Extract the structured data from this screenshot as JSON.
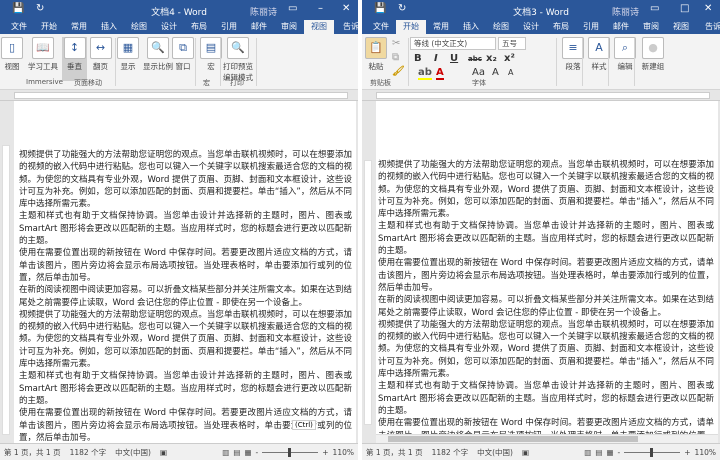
{
  "tabs": [
    "文件",
    "开始",
    "常用",
    "插入",
    "绘图",
    "设计",
    "布局",
    "引用",
    "邮件",
    "审阅",
    "视图"
  ],
  "tell_me": "告诉我",
  "user": "陈丽诗",
  "left": {
    "title": "文档4 - Word",
    "active_tab": 10,
    "buttons": [
      "视图",
      "学习工具",
      "垂直",
      "翻页",
      "显示",
      "显示比例",
      "窗口",
      "宏",
      "打印预览编辑模式"
    ],
    "groups": [
      "Immersive",
      "页面移动",
      "宏",
      "打印"
    ],
    "paste_options": "(Ctrl)"
  },
  "right": {
    "title": "文档3 - Word",
    "active_tab": 1,
    "paste": "粘贴",
    "font_name": "等线 (中文正文)",
    "font_size": "五号",
    "format_buttons": [
      "B",
      "I",
      "U",
      "abc",
      "x₂",
      "x²",
      "Aa",
      "A",
      "A"
    ],
    "buttons": [
      "段落",
      "样式",
      "编辑",
      "新建组"
    ],
    "groups": [
      "剪贴板",
      "字体"
    ]
  },
  "status": {
    "page": "第 1 页，共 1 页",
    "words": "1182 个字",
    "lang": "中文(中国)",
    "zoom": "110%"
  },
  "paragraphs": [
    "视频提供了功能强大的方法帮助您证明您的观点。当您单击联机视频时，可以在想要添加的视频的嵌入代码中进行粘贴。您也可以键入一个关键字以联机搜索最适合您的文档的视频。为使您的文档具有专业外观，Word 提供了页眉、页脚、封面和文本框设计，这些设计可互为补充。例如，您可以添加匹配的封面、页眉和提要栏。单击“插入”，然后从不同库中选择所需元素。",
    "主题和样式也有助于文档保持协调。当您单击设计并选择新的主题时，图片、图表或 SmartArt 图形将会更改以匹配新的主题。当应用样式时，您的标题会进行更改以匹配新的主题。",
    "使用在需要位置出现的新按钮在 Word 中保存时间。若要更改图片适应文档的方式，请单击该图片，图片旁边将会显示布局选项按钮。当处理表格时，单击要添加行或列的位置，然后单击加号。",
    "在新的阅读视图中阅读更加容易。可以折叠文档某些部分并关注所需文本。如果在达到结尾处之前需要停止读取，Word 会记住您的停止位置 - 即使在另一个设备上。"
  ]
}
